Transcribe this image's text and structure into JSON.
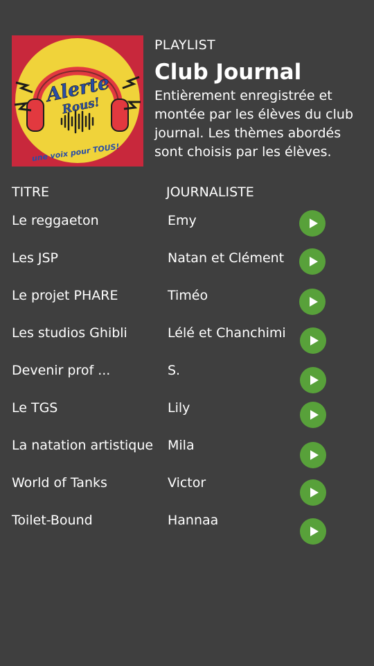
{
  "playlist": {
    "kind": "PLAYLIST",
    "title": "Club Journal",
    "description": "Entièrement enregistrée et montée par les élèves du club journal. Les thèmes abordés sont choisis par les élèves.",
    "cover": {
      "logo_text_line1": "Alerte",
      "logo_text_line2": "Rous!",
      "tagline": "une voix pour TOUS!",
      "colors": {
        "background": "#c8283c",
        "disc": "#f0d33a",
        "headphones": "#e2393f",
        "text": "#2a4ea6"
      }
    }
  },
  "table": {
    "col_title": "TITRE",
    "col_journalist": "JOURNALISTE",
    "rows": [
      {
        "title": "Le reggaeton",
        "journalist": "Emy"
      },
      {
        "title": "Les JSP",
        "journalist": "Natan et Clément"
      },
      {
        "title": "Le projet PHARE",
        "journalist": "Timéo"
      },
      {
        "title": "Les studios Ghibli",
        "journalist": "Lélé et Chanchimi"
      },
      {
        "title": "Devenir prof ...",
        "journalist": "S."
      },
      {
        "title": "Le TGS",
        "journalist": "Lily"
      },
      {
        "title": "La natation artistique",
        "journalist": "Mila"
      },
      {
        "title": "World of Tanks",
        "journalist": "Victor"
      },
      {
        "title": "Toilet-Bound",
        "journalist": "Hannaa"
      }
    ]
  },
  "colors": {
    "background": "#3f3f3f",
    "text": "#ffffff",
    "play_button": "#58a13a"
  },
  "icons": {
    "play": "play-icon"
  }
}
